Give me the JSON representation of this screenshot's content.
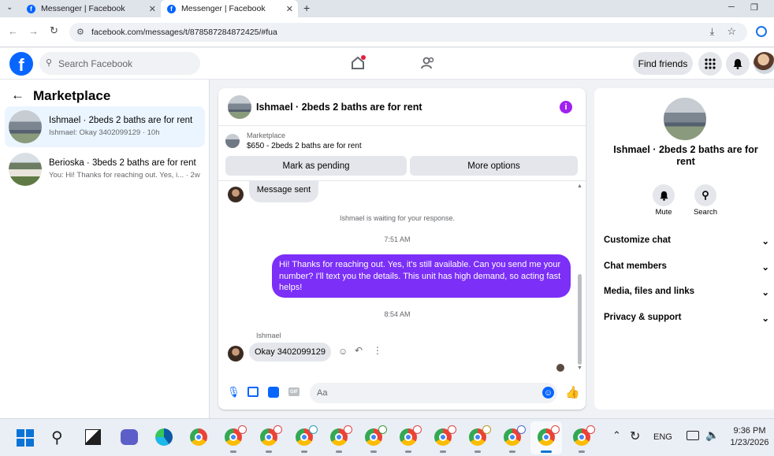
{
  "browser": {
    "tabs": [
      {
        "title": "Messenger | Facebook"
      },
      {
        "title": "Messenger | Facebook"
      }
    ],
    "url": "facebook.com/messages/t/878587284872425/#fua"
  },
  "fb_header": {
    "search_placeholder": "Search Facebook",
    "find_friends": "Find friends"
  },
  "left": {
    "title": "Marketplace",
    "conversations": [
      {
        "title": "Ishmael · 2beds 2 baths are for rent",
        "preview": "Ishmael: Okay 3402099129 · 10h"
      },
      {
        "title": "Berioska · 3beds 2 baths are for rent",
        "preview": "You: Hi! Thanks for reaching out. Yes, i... · 2w"
      }
    ]
  },
  "chat": {
    "header_title": "Ishmael · 2beds 2 baths are for rent",
    "listing_source": "Marketplace",
    "listing_text": "$650 - 2beds 2 baths are for rent",
    "mark_pending": "Mark as pending",
    "more_options": "More options",
    "sent_note": "Message sent",
    "waiting_text": "Ishmael is waiting for your response.",
    "time1": "7:51 AM",
    "outgoing_message": "Hi! Thanks for reaching out. Yes, it's still available. Can you send me your number? I'll text you the details. This unit has high demand, so acting fast helps!",
    "time2": "8:54 AM",
    "sender_name": "Ishmael",
    "incoming_message": "Okay 3402099129",
    "input_placeholder": "Aa",
    "accent_color": "#7b2ff7"
  },
  "right": {
    "title": "Ishmael · 2beds 2 baths are for rent",
    "mute": "Mute",
    "search": "Search",
    "sections": [
      "Customize chat",
      "Chat members",
      "Media, files and links",
      "Privacy & support"
    ]
  },
  "taskbar": {
    "language": "ENG",
    "time": "9:36 PM",
    "date": "1/23/2026"
  }
}
